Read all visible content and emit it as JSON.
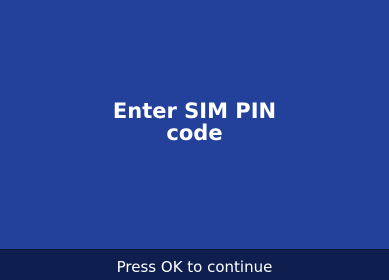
{
  "prompt": {
    "line1": "Enter SIM PIN",
    "line2": "code"
  },
  "footer": {
    "hint": "Press OK to continue"
  },
  "colors": {
    "background": "#23409a",
    "footer_bar": "#0e1e4e",
    "text": "#ffffff"
  }
}
